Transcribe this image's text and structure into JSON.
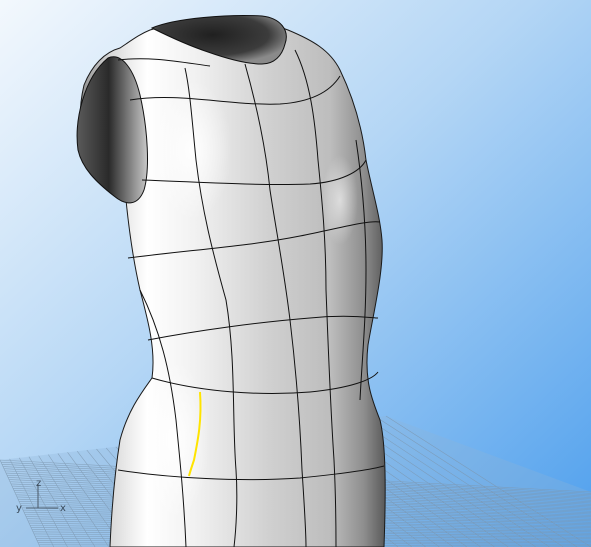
{
  "viewport": {
    "background_top": "#eaf4fc",
    "background_bottom": "#55a6ee",
    "grid_color": "#7e99b2",
    "surface_light": "#ffffff",
    "surface_mid": "#b9b9b9",
    "surface_dark": "#3a3a3a",
    "isocurve_color": "#111111",
    "selected_curve_color": "#ffe400"
  },
  "axis_gizmo": {
    "z_label": "z",
    "y_label": "y",
    "x_label": "x"
  }
}
